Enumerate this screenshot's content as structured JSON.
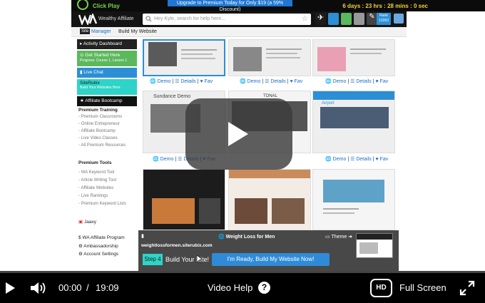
{
  "promo": {
    "click_play": "Click Play",
    "upgrade_text": "Upgrade to Premium Today for Only $19 (a 59% Discount)",
    "timer": "6 days : 23 hrs : 28 mins : 0 sec"
  },
  "header": {
    "brand": "Wealthy Affiliate",
    "search_placeholder": "Hey Kyle, search for help here...",
    "rank_label": "Rank 10263"
  },
  "subnav": {
    "site_badge": "Site",
    "manager": "Manager",
    "build": "Build My Website"
  },
  "sidebar": {
    "activity": "Activity Dashboard",
    "get_started": "Get Started Here",
    "progress": "Progress: Course 1, Lesson 1",
    "live_chat": "Live Chat",
    "siterubix": "SiteRubix",
    "siterubix_sub": "Build Your Websites Here",
    "bootcamp": "Affiliate Bootcamp",
    "training_head": "Premium Training",
    "training": [
      "Premium Classrooms",
      "Online Entrepreneur",
      "Affiliate Bootcamp",
      "Live Video Classes",
      "All Premium Resources"
    ],
    "tools_head": "Premium Tools",
    "tools": [
      "WA Keyword Tool",
      "Article Writing Tool",
      "Affiliate Websites",
      "Live Rankings",
      "Premium Keyword Lists"
    ],
    "jaaxy": "Jaaxy",
    "program": "WA Affiliate Program",
    "ambassador": "Ambassadorship",
    "account": "Account Settings"
  },
  "tile_actions": {
    "demo": "Demo",
    "details": "Details",
    "fav": "Fav"
  },
  "tiles": {
    "sundance": "Sundance Demo",
    "tonal": "TONAL",
    "airport": "Airport"
  },
  "step_overlay": {
    "url": "weightlossformen.siterubix.com",
    "title": "Weight Loss for Men",
    "theme": "Theme",
    "step": "Step 4",
    "build_text": "Build Your Site!",
    "ready_button": "I'm Ready, Build My Website Now!"
  },
  "controls": {
    "current_time": "00:00",
    "separator": "/",
    "duration": "19:09",
    "video_help": "Video Help",
    "help_icon": "?",
    "hd": "HD",
    "full_screen": "Full Screen"
  },
  "colors": {
    "wa_blue": "#1d6fc1",
    "green": "#5cb85c",
    "teal": "#2dd4c7",
    "accent_blue": "#2f8bd7"
  }
}
